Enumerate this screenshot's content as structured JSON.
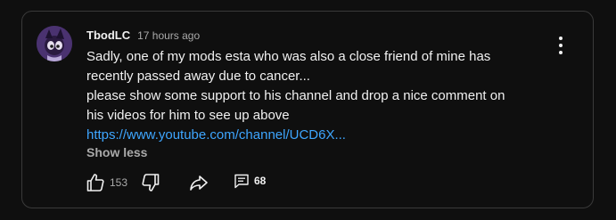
{
  "comment": {
    "author": "TbodLC",
    "timestamp": "17 hours ago",
    "lines": [
      "Sadly, one of my mods esta who was also a close friend of mine has",
      "recently passed away due to cancer...",
      "please show some support to his channel and drop a nice comment on",
      "his videos for him to see up above"
    ],
    "link_text": "https://www.youtube.com/channel/UCD6X...",
    "show_less_label": "Show less",
    "like_count": "153",
    "reply_count": "68"
  },
  "icons": {
    "like": "thumbs-up-icon",
    "dislike": "thumbs-down-icon",
    "share": "share-arrow-icon",
    "replies": "comment-bubble-icon",
    "menu": "more-vertical-icon"
  },
  "colors": {
    "background": "#0f0f0f",
    "border": "#3a3a3a",
    "text": "#f1f1f1",
    "secondary_text": "#aaaaaa",
    "link": "#3ea6ff"
  }
}
